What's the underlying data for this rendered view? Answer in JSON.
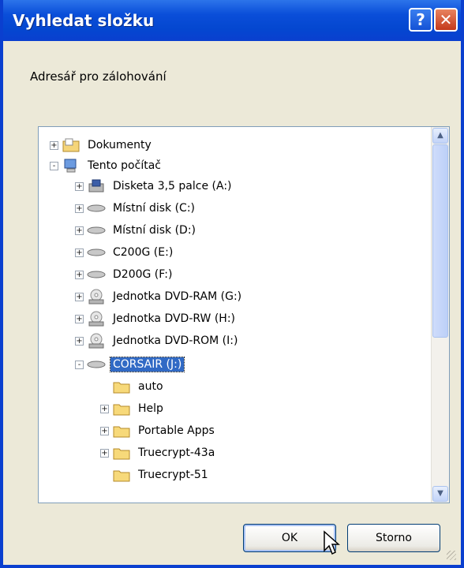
{
  "window": {
    "title": "Vyhledat složku"
  },
  "dialog": {
    "prompt": "Adresář pro zálohování"
  },
  "tree": {
    "items": [
      {
        "label": "Dokumenty",
        "icon": "my-documents-icon",
        "expander": "+"
      },
      {
        "label": "Tento počítač",
        "icon": "computer-icon",
        "expander": "-"
      },
      {
        "label": "Disketa 3,5 palce (A:)",
        "icon": "floppy-drive-icon",
        "expander": "+"
      },
      {
        "label": "Místní disk (C:)",
        "icon": "hard-disk-icon",
        "expander": "+"
      },
      {
        "label": "Místní disk (D:)",
        "icon": "hard-disk-icon",
        "expander": "+"
      },
      {
        "label": "C200G (E:)",
        "icon": "hard-disk-icon",
        "expander": "+"
      },
      {
        "label": "D200G (F:)",
        "icon": "hard-disk-icon",
        "expander": "+"
      },
      {
        "label": "Jednotka DVD-RAM (G:)",
        "icon": "dvd-drive-icon",
        "expander": "+"
      },
      {
        "label": "Jednotka DVD-RW (H:)",
        "icon": "dvd-drive-icon",
        "expander": "+"
      },
      {
        "label": "Jednotka DVD-ROM (I:)",
        "icon": "dvd-drive-icon",
        "expander": "+"
      },
      {
        "label": "CORSAIR (J:)",
        "icon": "removable-disk-icon",
        "expander": "-",
        "selected": true
      },
      {
        "label": "auto",
        "icon": "folder-icon",
        "expander": ""
      },
      {
        "label": "Help",
        "icon": "folder-icon",
        "expander": "+"
      },
      {
        "label": "Portable Apps",
        "icon": "folder-icon",
        "expander": "+"
      },
      {
        "label": "Truecrypt-43a",
        "icon": "folder-icon",
        "expander": "+"
      },
      {
        "label": "Truecrypt-51",
        "icon": "folder-icon",
        "expander": ""
      }
    ]
  },
  "buttons": {
    "ok": "OK",
    "cancel": "Storno"
  },
  "colors": {
    "selection": "#316ac5",
    "titlebar": "#0a4ed9"
  }
}
